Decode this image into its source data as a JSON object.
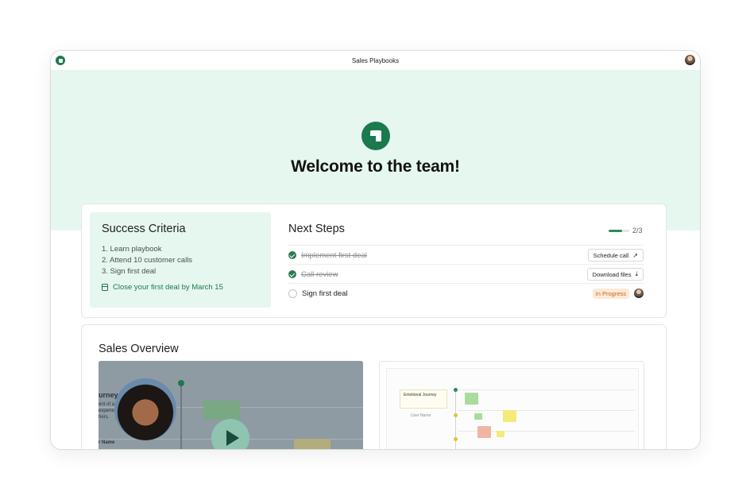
{
  "window": {
    "title": "Sales Playbooks"
  },
  "hero": {
    "title": "Welcome to the team!"
  },
  "success_criteria": {
    "title": "Success Criteria",
    "items": [
      "1. Learn playbook",
      "2. Attend 10 customer calls",
      "3. Sign first deal"
    ],
    "deadline": "Close your first deal by March 15"
  },
  "next_steps": {
    "title": "Next Steps",
    "progress_text": "2/3",
    "progress_fraction": 0.66,
    "steps": [
      {
        "label": "Implement first deal",
        "done": true,
        "action": "Schedule call",
        "action_icon": "↗"
      },
      {
        "label": "Call review",
        "done": true,
        "action": "Download files",
        "action_icon": "⤓"
      },
      {
        "label": "Sign first deal",
        "done": false,
        "status": "In Progress"
      }
    ]
  },
  "overview": {
    "title": "Sales Overview",
    "video_text": {
      "heading": "urney",
      "line1": "ent of a cu",
      "line2": "experience",
      "line3": "hers.",
      "footer": "r Name"
    },
    "board_text": {
      "card_title": "Emotional Journey",
      "col_label": "User Name"
    }
  },
  "colors": {
    "brand": "#1b7a4d",
    "hero_bg": "#e6f7ef",
    "badge_bg": "#fde9d6",
    "badge_fg": "#c56a1c"
  }
}
